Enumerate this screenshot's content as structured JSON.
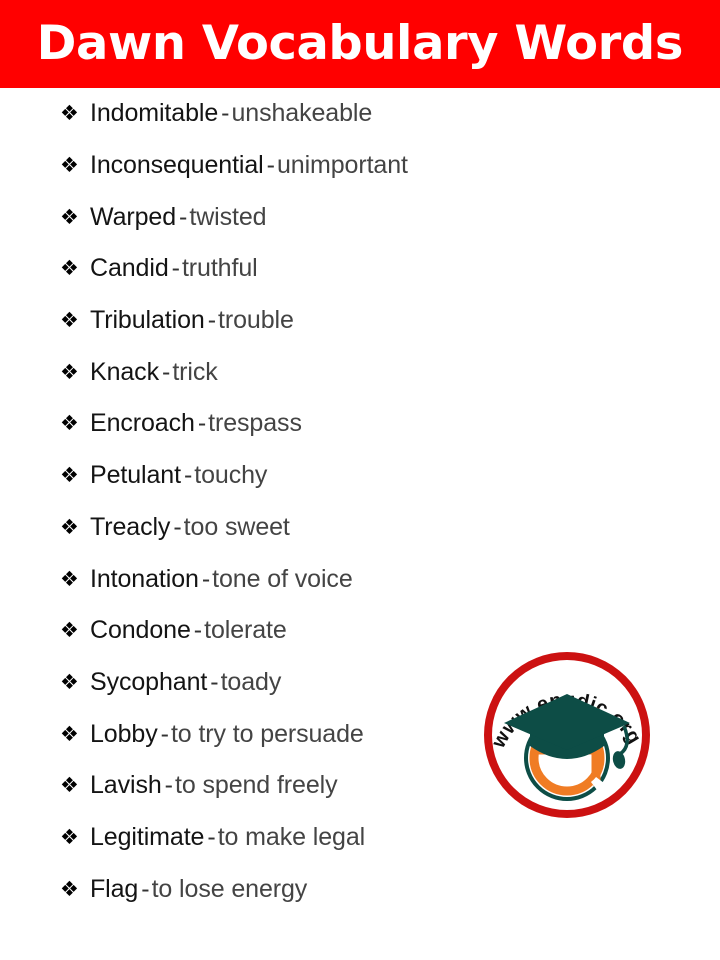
{
  "header": {
    "title": "Dawn Vocabulary Words",
    "background_color": "#ff0000",
    "text_color": "#ffffff"
  },
  "list": {
    "bullet_glyph": "❖",
    "separator": "-",
    "items": [
      {
        "word": "Indomitable",
        "definition": "unshakeable"
      },
      {
        "word": "Inconsequential",
        "definition": "unimportant"
      },
      {
        "word": "Warped",
        "definition": "twisted"
      },
      {
        "word": "Candid",
        "definition": "truthful"
      },
      {
        "word": "Tribulation",
        "definition": "trouble"
      },
      {
        "word": "Knack",
        "definition": "trick"
      },
      {
        "word": "Encroach",
        "definition": "trespass"
      },
      {
        "word": "Petulant",
        "definition": "touchy"
      },
      {
        "word": "Treacly",
        "definition": "too sweet"
      },
      {
        "word": "Intonation",
        "definition": "tone of voice"
      },
      {
        "word": "Condone",
        "definition": "tolerate"
      },
      {
        "word": "Sycophant",
        "definition": "toady"
      },
      {
        "word": "Lobby",
        "definition": "to try to persuade"
      },
      {
        "word": "Lavish",
        "definition": "to spend freely"
      },
      {
        "word": "Legitimate",
        "definition": "to make legal"
      },
      {
        "word": "Flag",
        "definition": "to lose energy"
      }
    ]
  },
  "logo": {
    "curved_text": "www.engdic.org",
    "ring_color": "#cc1111",
    "cap_color": "#0d4d46",
    "letter_color": "#f07c24",
    "letter": "e"
  }
}
